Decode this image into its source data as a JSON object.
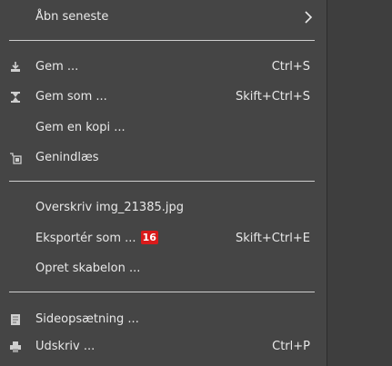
{
  "menu": {
    "items": [
      {
        "label": "Åbn seneste",
        "shortcut": "",
        "icon": "",
        "submenu": true
      },
      {
        "label": "Gem ...",
        "shortcut": "Ctrl+S",
        "icon": "save-icon"
      },
      {
        "label": "Gem som ...",
        "shortcut": "Skift+Ctrl+S",
        "icon": "save-as-icon"
      },
      {
        "label": "Gem en kopi ...",
        "shortcut": "",
        "icon": ""
      },
      {
        "label": "Genindlæs",
        "shortcut": "",
        "icon": "revert-icon"
      },
      {
        "label": "Overskriv img_21385.jpg",
        "shortcut": "",
        "icon": ""
      },
      {
        "label": "Eksportér som ...",
        "shortcut": "Skift+Ctrl+E",
        "icon": "",
        "badge": "16"
      },
      {
        "label": "Opret skabelon ...",
        "shortcut": "",
        "icon": ""
      },
      {
        "label": "Sideopsætning ...",
        "shortcut": "",
        "icon": "page-setup-icon"
      },
      {
        "label": "Udskriv ...",
        "shortcut": "Ctrl+P",
        "icon": "print-icon"
      }
    ]
  },
  "colors": {
    "background": "#454545",
    "text": "#e8e8e8",
    "separator": "#cfcfcf",
    "badge": "#d91b1b"
  }
}
